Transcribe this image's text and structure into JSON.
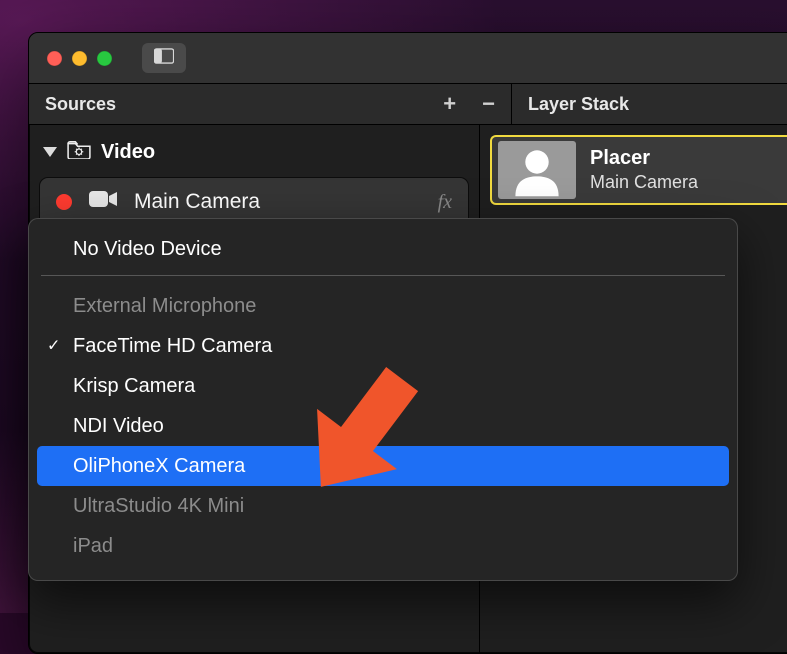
{
  "header": {
    "sources_title": "Sources",
    "layerstack_title": "Layer Stack",
    "add_symbol": "+",
    "remove_symbol": "−"
  },
  "sources": {
    "group_label": "Video",
    "item": {
      "name": "Main Camera",
      "fx_label": "fx"
    }
  },
  "layerstack": {
    "card": {
      "title": "Placer",
      "subtitle": "Main Camera"
    }
  },
  "dropdown": {
    "top_option": "No Video Device",
    "options": [
      {
        "label": "External Microphone",
        "dim": true,
        "checked": false,
        "selected": false
      },
      {
        "label": "FaceTime HD Camera",
        "dim": false,
        "checked": true,
        "selected": false
      },
      {
        "label": "Krisp Camera",
        "dim": false,
        "checked": false,
        "selected": false
      },
      {
        "label": "NDI Video",
        "dim": false,
        "checked": false,
        "selected": false
      },
      {
        "label": "OliPhoneX Camera",
        "dim": false,
        "checked": false,
        "selected": true
      },
      {
        "label": "UltraStudio 4K Mini",
        "dim": true,
        "checked": false,
        "selected": false
      },
      {
        "label": "iPad",
        "dim": true,
        "checked": false,
        "selected": false
      }
    ]
  },
  "colors": {
    "selection_blue": "#1e6ff5",
    "annotation_orange": "#f0552b",
    "highlight_yellow": "#f1da3f"
  }
}
